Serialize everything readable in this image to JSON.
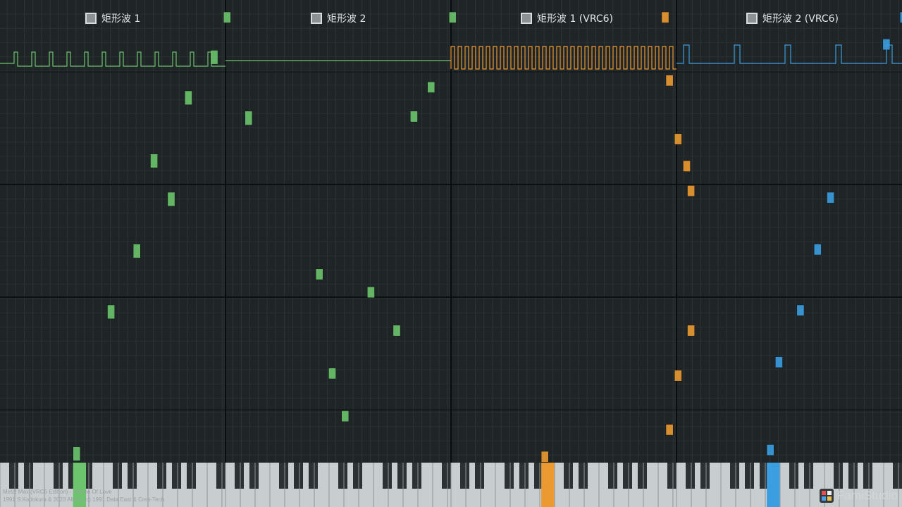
{
  "colors": {
    "background": "#1f2426",
    "grid_line": "#2d3437",
    "grid_major": "#0d1011",
    "channel_separator": "#0a0c0d",
    "white_key": "#c8cdd0",
    "black_key": "#2c3134",
    "green": "#6cc46c",
    "orange": "#eb9a31",
    "blue": "#3a9ee1"
  },
  "channels": [
    {
      "name": "矩形波 1",
      "color": "#6cc46c",
      "waveform": "duty-low",
      "active_key": 17,
      "notes": [
        {
          "key": 52,
          "start": 0.0,
          "length": 0.14
        },
        {
          "key": 49,
          "start": 0.34,
          "length": 0.18
        },
        {
          "key": 43,
          "start": 0.7,
          "length": 0.18
        },
        {
          "key": 57,
          "start": 0.88,
          "length": 0.18
        },
        {
          "key": 35,
          "start": 1.26,
          "length": 0.18
        },
        {
          "key": 39,
          "start": 1.6,
          "length": 0.18
        },
        {
          "key": 31,
          "start": 2.06,
          "length": 0.18
        },
        {
          "key": 25,
          "start": 2.6,
          "length": 0.18
        },
        {
          "key": 17,
          "start": 3.86,
          "length": 0.18
        }
      ]
    },
    {
      "name": "矩形波 2",
      "color": "#6cc46c",
      "waveform": "flat",
      "active_key": null,
      "notes": [
        {
          "key": 52,
          "start": 0.0,
          "length": 0.14
        },
        {
          "key": 47,
          "start": 0.62,
          "length": 0.14
        },
        {
          "key": 43,
          "start": 0.88,
          "length": 0.14
        },
        {
          "key": 21,
          "start": 2.28,
          "length": 0.14
        },
        {
          "key": 33,
          "start": 2.44,
          "length": 0.14
        },
        {
          "key": 39,
          "start": 2.78,
          "length": 0.14
        },
        {
          "key": 24,
          "start": 3.16,
          "length": 0.14
        },
        {
          "key": 27,
          "start": 3.54,
          "length": 0.14
        }
      ]
    },
    {
      "name": "矩形波 1 (VRC6)",
      "color": "#eb9a31",
      "waveform": "dense",
      "active_key": 21,
      "notes": [
        {
          "key": 49,
          "start": 0.0,
          "length": 0.14
        },
        {
          "key": 50,
          "start": 0.56,
          "length": 0.14
        },
        {
          "key": 52,
          "start": 1.08,
          "length": 0.14
        },
        {
          "key": 54,
          "start": 1.32,
          "length": 0.14
        },
        {
          "key": 55,
          "start": 1.54,
          "length": 0.14
        },
        {
          "key": 55,
          "start": 2.78,
          "length": 0.14
        },
        {
          "key": 52,
          "start": 3.18,
          "length": 0.14
        },
        {
          "key": 50,
          "start": 3.66,
          "length": 0.14
        },
        {
          "key": 21,
          "start": 3.9,
          "length": 0.14
        }
      ]
    },
    {
      "name": "矩形波 2 (VRC6)",
      "color": "#3a9ee1",
      "waveform": "duty-wide",
      "active_key": 21,
      "notes": [
        {
          "key": 48,
          "start": 0.24,
          "length": 0.14
        },
        {
          "key": 52,
          "start": 0.0,
          "length": 0.14
        },
        {
          "key": 59,
          "start": 0.88,
          "length": 0.14
        },
        {
          "key": 55,
          "start": 1.26,
          "length": 0.14
        },
        {
          "key": 35,
          "start": 1.6,
          "length": 0.14
        },
        {
          "key": 32,
          "start": 2.06,
          "length": 0.14
        },
        {
          "key": 28,
          "start": 2.6,
          "length": 0.14
        },
        {
          "key": 23,
          "start": 3.06,
          "length": 0.14
        },
        {
          "key": 21,
          "start": 3.84,
          "length": 0.14
        }
      ]
    }
  ],
  "footer": {
    "line1": "Metal Max (VRC6 Edition) - Theme Of Love",
    "line2": "1991 S.Kadokura & 2023 Allang (c) 1991 Data East & Crea-Tech"
  },
  "brand": {
    "name": "FamiStudio",
    "icon": "famistudio-logo-icon"
  }
}
